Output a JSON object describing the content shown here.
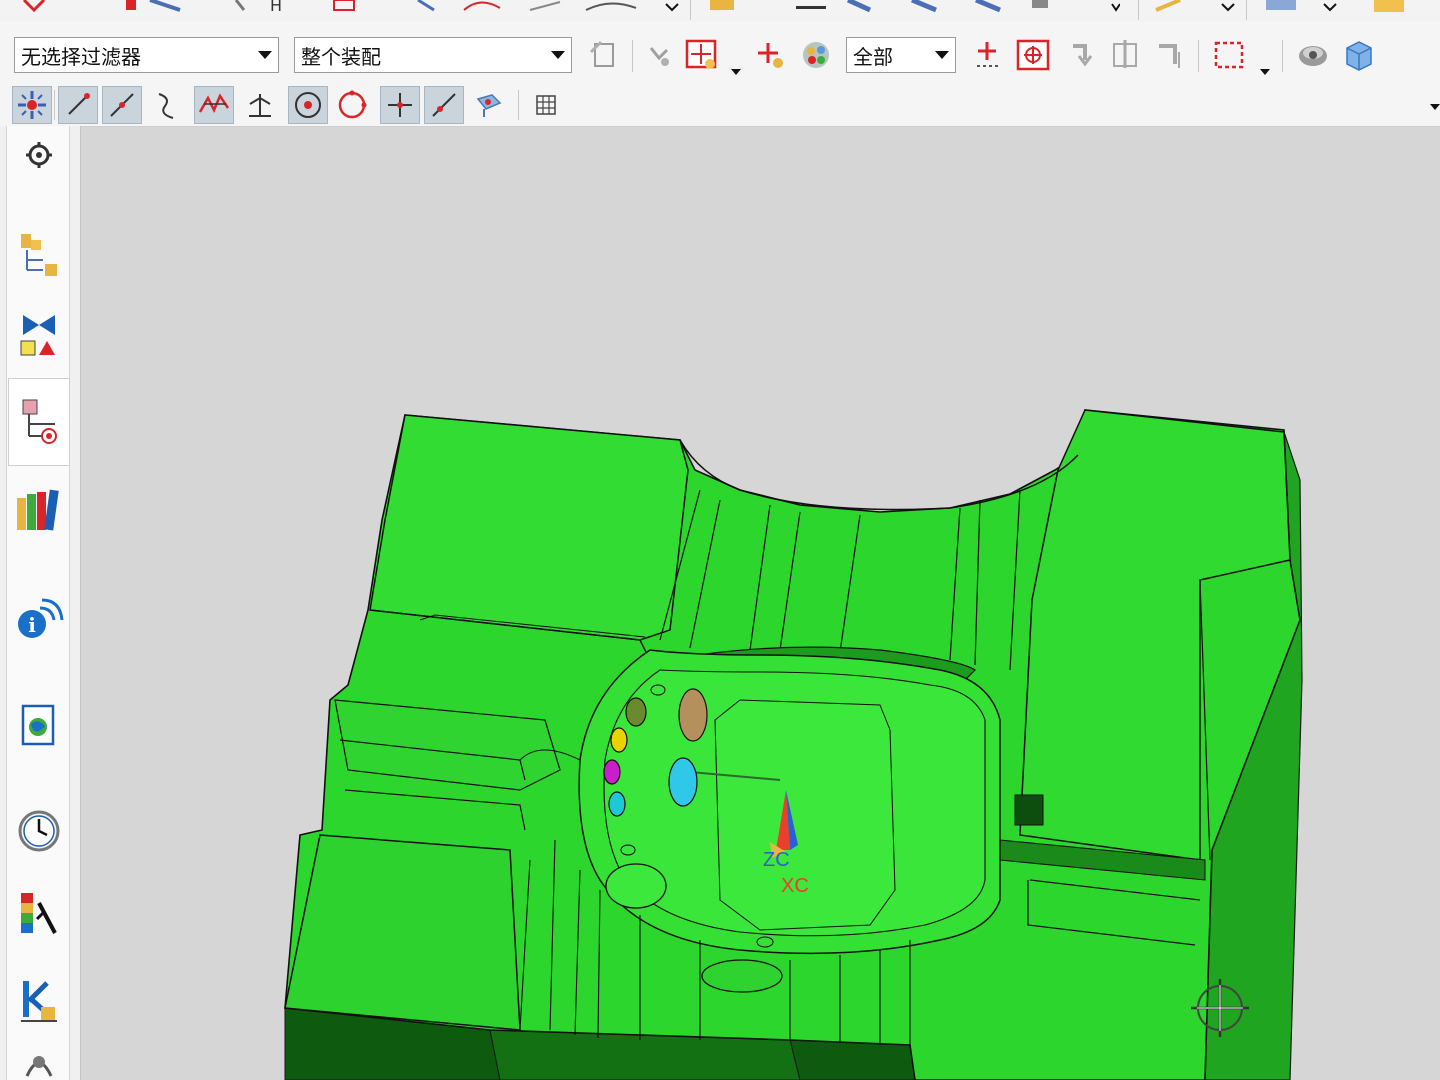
{
  "toolbar": {
    "selection_filter": {
      "value": "无选择过滤器"
    },
    "selection_scope": {
      "value": "整个装配"
    },
    "layer_scope": {
      "value": "全部"
    }
  },
  "snap_toolbar": {
    "buttons": [
      {
        "name": "enable-snap-point",
        "on": true
      },
      {
        "name": "endpoint",
        "on": true
      },
      {
        "name": "midpoint",
        "on": true
      },
      {
        "name": "control-point",
        "on": false
      },
      {
        "name": "intersection",
        "on": true
      },
      {
        "name": "perpendicular",
        "on": false
      },
      {
        "name": "arc-center",
        "on": true
      },
      {
        "name": "quadrant",
        "on": false
      },
      {
        "name": "existing-point",
        "on": true
      },
      {
        "name": "point-on-curve",
        "on": true
      },
      {
        "name": "point-on-face",
        "on": false
      },
      {
        "name": "bounded-grid",
        "on": false
      }
    ]
  },
  "resource_bar": {
    "items": [
      "settings-icon",
      "assembly-navigator-icon",
      "constraint-navigator-icon",
      "part-navigator-icon",
      "reuse-library-icon",
      "hd3d-tools-icon",
      "web-browser-icon",
      "history-icon",
      "system-materials-icon",
      "process-studio-icon",
      "roles-icon"
    ],
    "active": "part-navigator-icon"
  },
  "viewport": {
    "wcs": {
      "z_label": "ZC",
      "x_label": "XC"
    },
    "model_color": "#2dd62d",
    "background": "#d6d6d6",
    "pins": [
      "#6b8a2f",
      "#e8d200",
      "#c81fc8",
      "#1fc8d8",
      "#b4905c",
      "#2fc8e8"
    ]
  },
  "colors": {
    "toolbar_bg": "#f5f5f5",
    "toggle_on": "#c9d4dc",
    "accent_red": "#d9252a"
  }
}
